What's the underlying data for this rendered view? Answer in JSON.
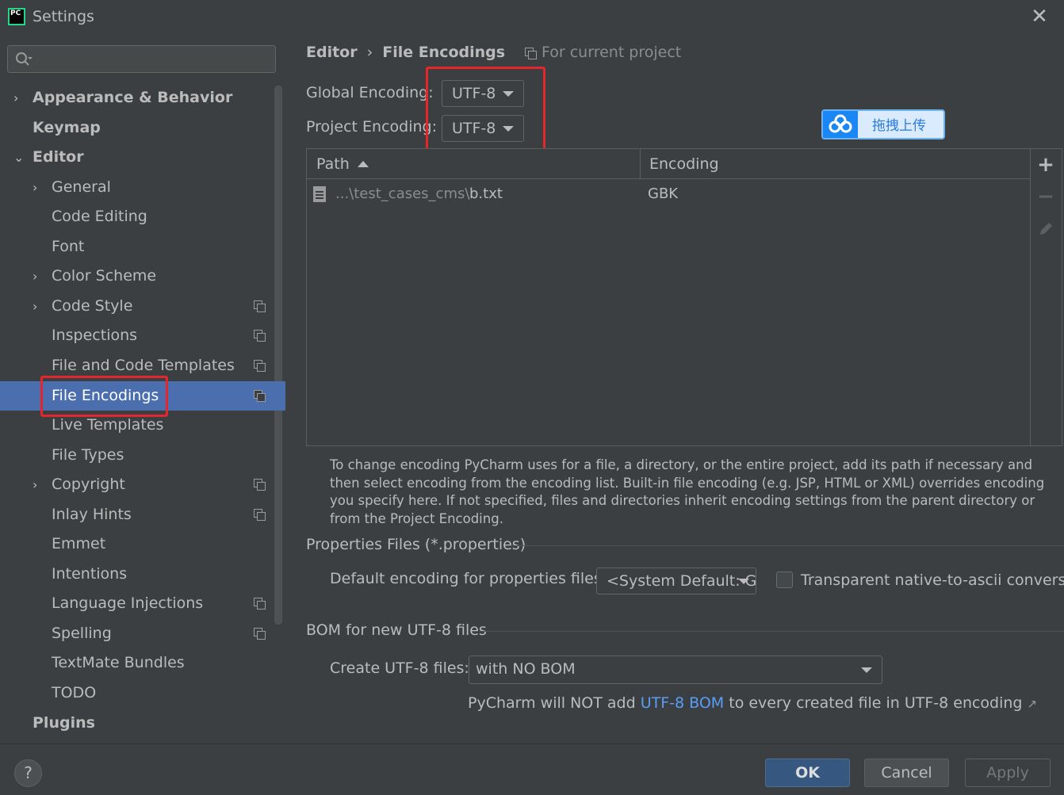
{
  "window": {
    "title": "Settings",
    "logo_text": "PC"
  },
  "sidebar": {
    "search": {
      "placeholder": ""
    },
    "items": [
      {
        "label": "Appearance & Behavior",
        "chevron": "›",
        "bold": true
      },
      {
        "label": "Keymap",
        "bold": true
      },
      {
        "label": "Editor",
        "chevron": "⌄",
        "bold": true
      },
      {
        "label": "General",
        "chevron": "›"
      },
      {
        "label": "Code Editing"
      },
      {
        "label": "Font"
      },
      {
        "label": "Color Scheme",
        "chevron": "›"
      },
      {
        "label": "Code Style",
        "chevron": "›",
        "project_icon": true
      },
      {
        "label": "Inspections",
        "project_icon": true
      },
      {
        "label": "File and Code Templates",
        "project_icon": true
      },
      {
        "label": "File Encodings",
        "project_icon": true,
        "selected": true
      },
      {
        "label": "Live Templates"
      },
      {
        "label": "File Types"
      },
      {
        "label": "Copyright",
        "chevron": "›",
        "project_icon": true
      },
      {
        "label": "Inlay Hints",
        "project_icon": true
      },
      {
        "label": "Emmet"
      },
      {
        "label": "Intentions"
      },
      {
        "label": "Language Injections",
        "project_icon": true
      },
      {
        "label": "Spelling",
        "project_icon": true
      },
      {
        "label": "TextMate Bundles"
      },
      {
        "label": "TODO"
      },
      {
        "label": "Plugins",
        "bold": true
      }
    ]
  },
  "breadcrumb": {
    "parent": "Editor",
    "separator": "›",
    "current": "File Encodings",
    "scope": "For current project"
  },
  "encodings": {
    "global_label": "Global Encoding:",
    "global_value": "UTF-8",
    "project_label": "Project Encoding:",
    "project_value": "UTF-8"
  },
  "upload_button": {
    "label": "拖拽上传"
  },
  "table": {
    "columns": [
      "Path",
      "Encoding"
    ],
    "rows": [
      {
        "path_prefix": "...\\test_cases_cms\\",
        "path_file": "b.txt",
        "encoding": "GBK"
      }
    ]
  },
  "help_text": "To change encoding PyCharm uses for a file, a directory, or the entire project, add its path if necessary and then select encoding from the encoding list. Built-in file encoding (e.g. JSP, HTML or XML) overrides encoding you specify here. If not specified, files and directories inherit encoding settings from the parent directory or from the Project Encoding.",
  "properties": {
    "section_title": "Properties Files (*.properties)",
    "default_label": "Default encoding for properties files:",
    "default_value": "<System Default: G...",
    "native_label": "Transparent native-to-ascii conversion",
    "native_checked": false
  },
  "bom": {
    "section_title": "BOM for new UTF-8 files",
    "create_label": "Create UTF-8 files:",
    "create_value": "with NO BOM",
    "note_prefix": "PyCharm will NOT add ",
    "note_link": "UTF-8 BOM",
    "note_suffix": " to every created file in UTF-8 encoding",
    "note_icon": "↗"
  },
  "footer": {
    "help": "?",
    "ok": "OK",
    "cancel": "Cancel",
    "apply": "Apply"
  },
  "colors": {
    "background": "#3c3f41",
    "selection": "#4b6eaf",
    "highlight_box": "#e5262b",
    "link": "#589df6",
    "primary_button": "#365880"
  }
}
